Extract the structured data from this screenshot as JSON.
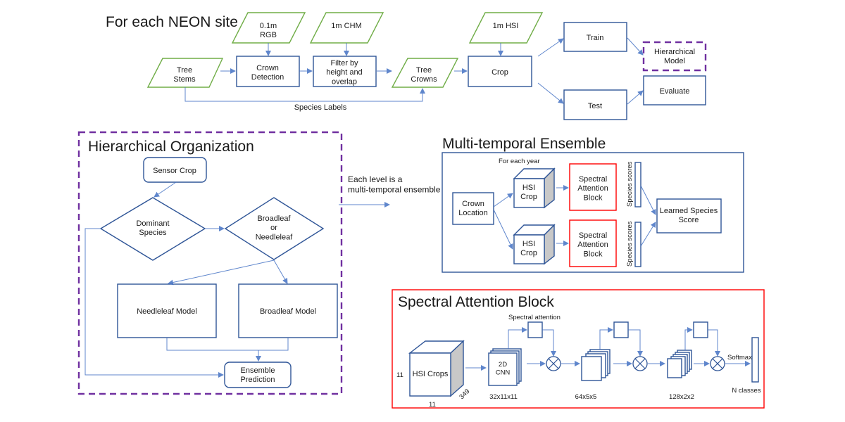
{
  "pipeline": {
    "title": "For each NEON site",
    "inputs": {
      "rgb": "0.1m\nRGB",
      "chm": "1m CHM",
      "hsi": "1m HSI",
      "tree_stems": "Tree\nStems",
      "tree_crowns": "Tree\nCrowns"
    },
    "steps": {
      "crown_detection": "Crown\nDetection",
      "filter": "Filter by\nheight and\noverlap",
      "crop": "Crop",
      "train": "Train",
      "test": "Test",
      "hierarchical_model": "Hierarchical\nModel",
      "evaluate": "Evaluate"
    },
    "edge_labels": {
      "species_labels": "Species Labels"
    }
  },
  "hierarchy": {
    "title": "Hierarchical Organization",
    "nodes": {
      "sensor_crop": "Sensor Crop",
      "dominant_species": "Dominant\nSpecies",
      "broadleaf_or_needleleaf": "Broadleaf\nor\nNeedleleaf",
      "needleleaf_model": "Needleleaf Model",
      "broadleaf_model": "Broadleaf Model",
      "ensemble_prediction": "Ensemble\nPrediction"
    }
  },
  "bridge": {
    "note": "Each level is a\nmulti-temporal ensemble"
  },
  "ensemble": {
    "title": "Multi-temporal Ensemble",
    "for_each_year": "For each year",
    "crown_location": "Crown\nLocation",
    "hsi_crop": "HSI\nCrop",
    "spectral_attention_block": "Spectral\nAttention\nBlock",
    "species_scores": "Species scores",
    "learned_species_score": "Learned Species\nScore"
  },
  "spectral_block": {
    "title": "Spectral Attention Block",
    "hsi_crops": "HSI Crops",
    "dim_height": "11",
    "dim_width": "11",
    "dim_depth": "349",
    "cnn": "2D\nCNN",
    "spectral_attention": "Spectral attention",
    "shapes": [
      "32x11x11",
      "64x5x5",
      "128x2x2"
    ],
    "softmax": "Softmax",
    "n_classes": "N classes"
  },
  "colors": {
    "process_border": "#2f5597",
    "data_border": "#70ad47",
    "highlight_border": "#ff0000",
    "model_dashed": "#7030a0",
    "arrow": "#4472c4"
  }
}
